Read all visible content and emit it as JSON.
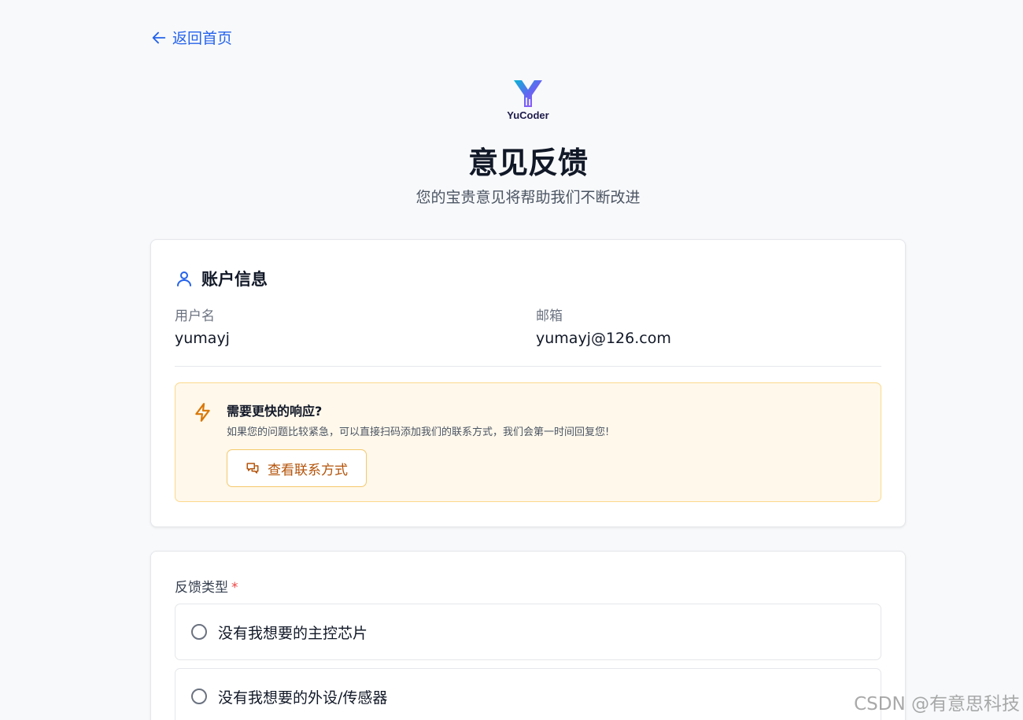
{
  "nav": {
    "back_label": "返回首页"
  },
  "brand": {
    "name": "YuCoder",
    "primary_color": "#2563eb"
  },
  "header": {
    "title": "意见反馈",
    "subtitle": "您的宝贵意见将帮助我们不断改进"
  },
  "account": {
    "title": "账户信息",
    "username_label": "用户名",
    "username_value": "yumayj",
    "email_label": "邮箱",
    "email_value": "yumayj@126.com"
  },
  "notice": {
    "title": "需要更快的响应?",
    "description": "如果您的问题比较紧急，可以直接扫码添加我们的联系方式，我们会第一时间回复您!",
    "button_label": "查看联系方式",
    "accent_color": "#d97706"
  },
  "feedback": {
    "type_label": "反馈类型",
    "required_mark": "*",
    "options": [
      {
        "label": "没有我想要的主控芯片",
        "selected": false
      },
      {
        "label": "没有我想要的外设/传感器",
        "selected": false
      }
    ]
  },
  "watermark": "CSDN @有意思科技"
}
